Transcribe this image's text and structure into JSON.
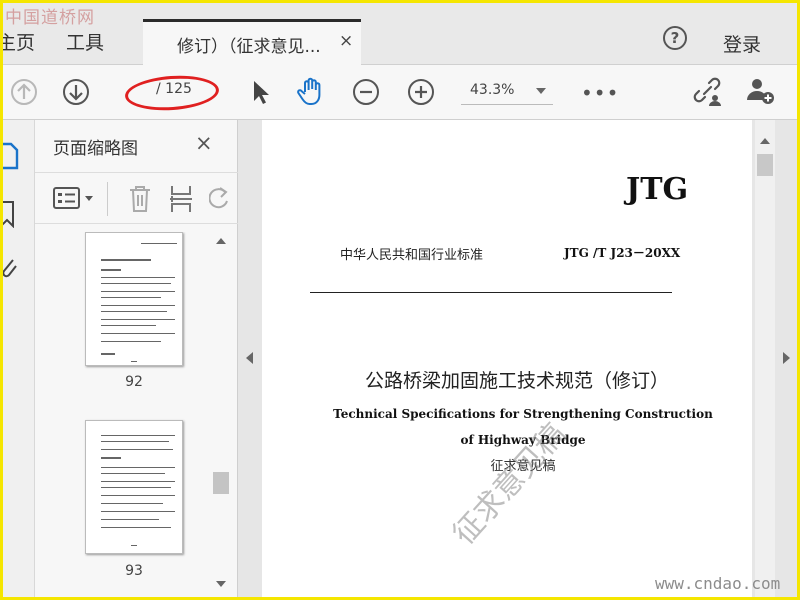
{
  "watermarks": {
    "top_left": "中国道桥网",
    "bottom_right": "www.cndao.com",
    "document_stamp": "征求意见稿"
  },
  "menu": {
    "home_label": "主页",
    "tools_label": "工具",
    "login_label": "登录"
  },
  "tab": {
    "label": "修订）（征求意见...",
    "close": "×"
  },
  "toolbar": {
    "page_input_value": "",
    "page_total": "/ 125",
    "zoom_value": "43.3%",
    "more_label": "•••"
  },
  "panel": {
    "title": "页面缩略图",
    "close": "×",
    "thumbnails": [
      {
        "page_label": "92"
      },
      {
        "page_label": "93"
      }
    ]
  },
  "document": {
    "logo": "JTG",
    "standard_label": "中华人民共和国行业标准",
    "standard_code": "JTG /T J23－20XX",
    "title_cn": "公路桥梁加固施工技术规范（修订）",
    "title_en_line1": "Technical Specifications for Strengthening Construction",
    "title_en_line2": "of Highway Bridge",
    "draft_label": "征求意见稿"
  },
  "colors": {
    "frame_border": "#f5e600",
    "annotation_ellipse": "#e02020",
    "hand_tool_active": "#1a73c9"
  }
}
